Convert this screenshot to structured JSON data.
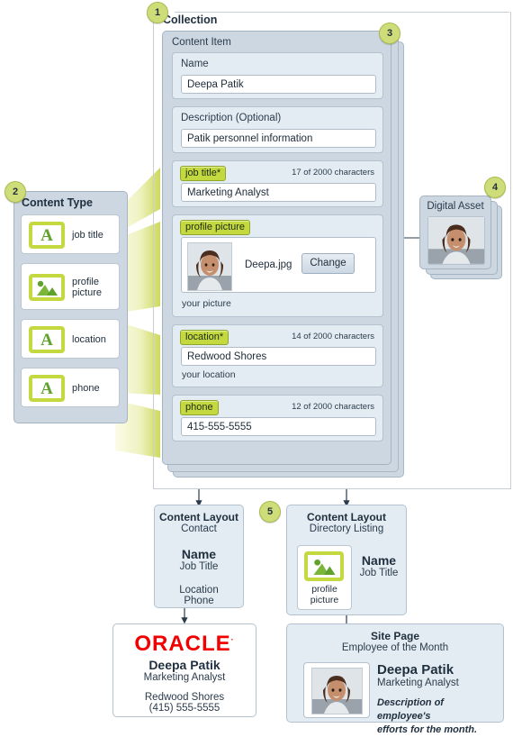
{
  "diagram": {
    "badges": [
      "1",
      "2",
      "3",
      "4",
      "5"
    ]
  },
  "collection": {
    "title": "Collection"
  },
  "content_item": {
    "title": "Content Item",
    "fields": [
      {
        "label": "Name",
        "value": "Deepa Patik",
        "charcount": "",
        "helper": "",
        "tag": false
      },
      {
        "label": "Description (Optional)",
        "value": "Patik personnel information",
        "charcount": "",
        "helper": "",
        "tag": false
      },
      {
        "label": "job title*",
        "value": "Marketing Analyst",
        "charcount": "17 of 2000 characters",
        "helper": "",
        "tag": true
      },
      {
        "label": "profile picture",
        "value": "Deepa.jpg",
        "charcount": "",
        "helper": "your picture",
        "tag": true,
        "button": "Change"
      },
      {
        "label": "location*",
        "value": "Redwood Shores",
        "charcount": "14 of 2000 characters",
        "helper": "your location",
        "tag": true
      },
      {
        "label": "phone",
        "value": "415-555-5555",
        "charcount": "12 of 2000 characters",
        "helper": "",
        "tag": true
      }
    ]
  },
  "content_type": {
    "title": "Content Type",
    "items": [
      {
        "icon": "text-field-icon",
        "glyph": "A",
        "label": "job title"
      },
      {
        "icon": "image-field-icon",
        "glyph": "",
        "label": "profile\npicture"
      },
      {
        "icon": "text-field-icon",
        "glyph": "A",
        "label": "location"
      },
      {
        "icon": "text-field-icon",
        "glyph": "A",
        "label": "phone"
      }
    ],
    "labels": [
      "job title",
      "profile picture",
      "location",
      "phone"
    ]
  },
  "digital_asset": {
    "title": "Digital Asset"
  },
  "content_layouts": [
    {
      "title": "Content Layout",
      "subtitle": "Contact",
      "name": "Name",
      "job_title": "Job Title",
      "location": "Location",
      "phone": "Phone"
    },
    {
      "title": "Content Layout",
      "subtitle": "Directory Listing",
      "name": "Name",
      "job_title": "Job Title",
      "picture_label": "profile\npicture",
      "picture_label_line1": "profile",
      "picture_label_line2": "picture"
    }
  ],
  "business_card": {
    "logo": "ORACLE",
    "logo_mark": "·",
    "name": "Deepa Patik",
    "job_title": "Marketing Analyst",
    "location": "Redwood Shores",
    "phone": "(415) 555-5555"
  },
  "site_page": {
    "title": "Site Page",
    "subtitle": "Employee of the Month",
    "name": "Deepa Patik",
    "job_title": "Marketing Analyst",
    "description_line1": "Description of employee's",
    "description_line2": "efforts for the month."
  },
  "colors": {
    "panel": "#ccd7e2",
    "field": "#e3ecf3",
    "tag_green": "#c3d93f",
    "badge": "#cfdc7a",
    "oracle_red": "#f20000",
    "text": "#2b3b4b"
  }
}
